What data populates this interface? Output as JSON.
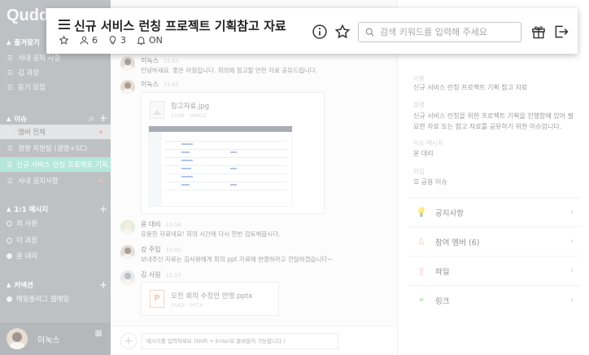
{
  "app": {
    "logo": "Quddi"
  },
  "sidebar": {
    "favorites": {
      "title": "즐겨찾기",
      "items": [
        {
          "label": "사내 공지 사항"
        },
        {
          "label": "김 과장"
        },
        {
          "label": "동기 모임"
        }
      ]
    },
    "issues": {
      "title": "이슈",
      "items": [
        {
          "label": "멤버 전체"
        },
        {
          "label": "경영 지원팀 (경영+SC)"
        },
        {
          "label": "신규 서비스 런칭 프로젝트 기획..."
        },
        {
          "label": "사내 공지사항"
        }
      ]
    },
    "dms": {
      "title": "1:1 메시지",
      "items": [
        {
          "label": "최 사원"
        },
        {
          "label": "이 과장"
        },
        {
          "label": "윤 대리"
        }
      ]
    },
    "connections": {
      "title": "커넥션",
      "items": [
        {
          "label": "메일플러그 웹메일"
        }
      ]
    },
    "user": {
      "name": "이눅스"
    }
  },
  "header": {
    "title": "신규 서비스 런칭 프로젝트 기획참고 자료",
    "members": "6",
    "pins": "3",
    "notify": "ON",
    "search_placeholder": "검색 키워드를 입력해 주세요"
  },
  "chat": {
    "messages": [
      {
        "name": "이눅스",
        "time": "11:51",
        "text": "안녕하세요. 좋은 아침입니다. 회의에 참고할 만한 자료 공유드립니다."
      },
      {
        "name": "이눅스",
        "time": "11:51",
        "file": {
          "name": "참고자료.jpg",
          "meta": "25KB · IMAGE"
        }
      },
      {
        "name": "윤 대리",
        "time": "11:58",
        "text": "유용한 자료네요! 회의 시간에 다시 한번 검토해봅시다."
      },
      {
        "name": "강 주임",
        "time": "12:05",
        "text": "보내주신 자료는 김사원에게 회의 ppt 자료에 반영하라고 전달하겠습니다~"
      },
      {
        "name": "김 사원",
        "time": "12:13",
        "file": {
          "name": "오전 회의 수정안 반영.pptx",
          "meta": "25KB · PPTX"
        }
      }
    ],
    "input_placeholder": "메시지를 입력하세요 (Shift + Enter로 줄바꿈이 가능합니다.)"
  },
  "panel": {
    "name_label": "이름",
    "name_value": "신규 서비스 런칭 프로젝트 기획 참고 자료",
    "desc_label": "설명",
    "desc_value": "신규 서비스 런칭을 위한 프로젝트 기획을 진행함에 있어 필요한 자료 또는 참고 자료를 공유하기 위한 이슈입니다.",
    "manager_label": "이슈 매니저",
    "manager_value": "윤 대리",
    "type_label": "타입",
    "type_value": "공용 이슈",
    "links": [
      {
        "label": "공지사항",
        "icon": "bulb-icon",
        "color": "#9fd3c7"
      },
      {
        "label": "참여 멤버 (6)",
        "icon": "member-icon",
        "color": "#f0a878"
      },
      {
        "label": "파일",
        "icon": "file-icon",
        "color": "#f29a9a"
      },
      {
        "label": "링크",
        "icon": "link-icon",
        "color": "#8fd18f"
      }
    ]
  }
}
